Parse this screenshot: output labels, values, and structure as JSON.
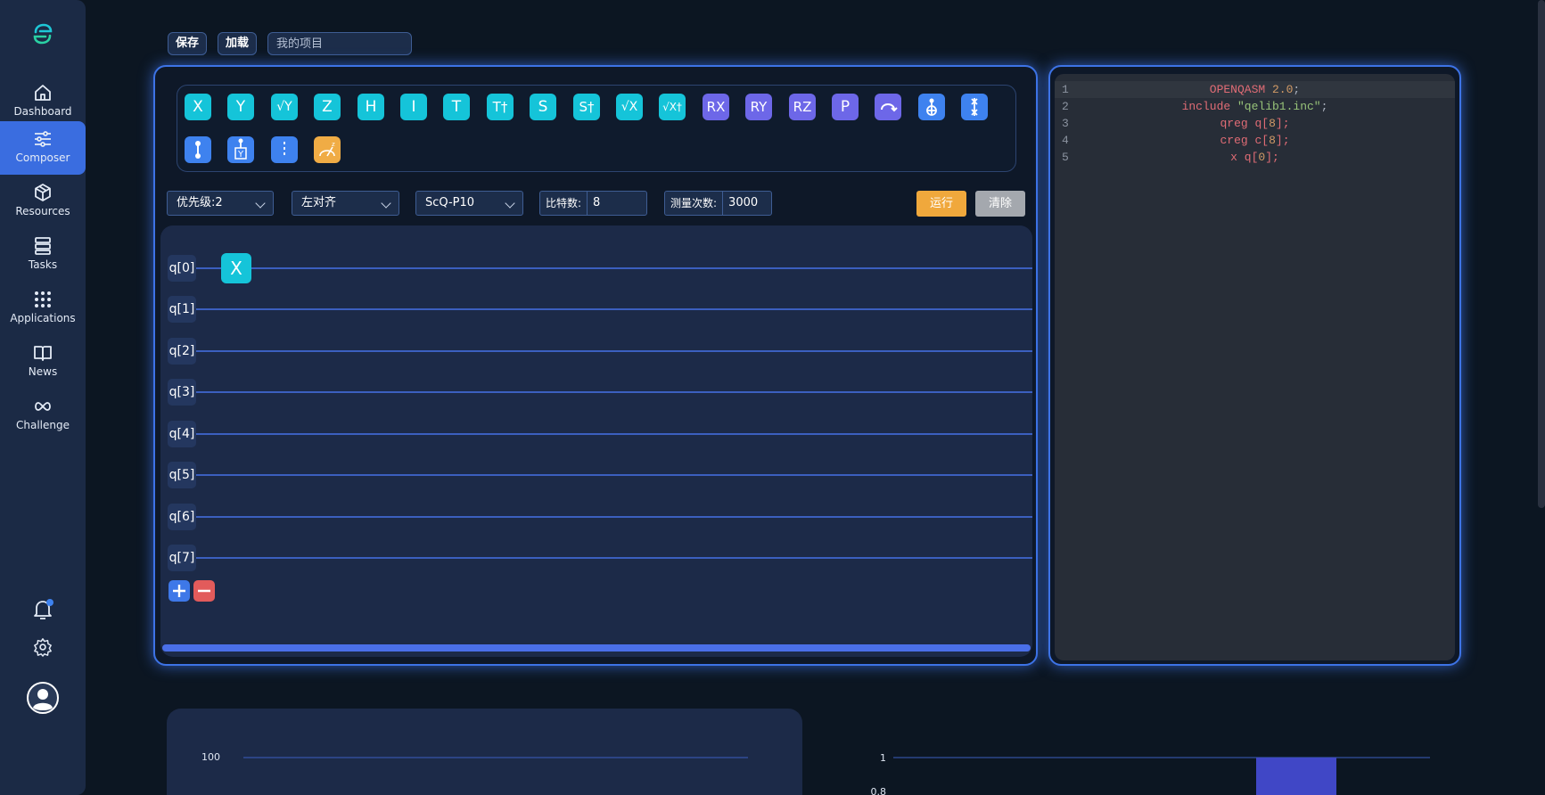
{
  "sidebar": {
    "items": [
      {
        "label": "Dashboard",
        "icon": "home-icon"
      },
      {
        "label": "Composer",
        "icon": "sliders-icon"
      },
      {
        "label": "Resources",
        "icon": "cube-icon"
      },
      {
        "label": "Tasks",
        "icon": "stack-icon"
      },
      {
        "label": "Applications",
        "icon": "grid-icon"
      },
      {
        "label": "News",
        "icon": "book-icon"
      },
      {
        "label": "Challenge",
        "icon": "infinity-icon"
      }
    ],
    "active": "Composer"
  },
  "toolbar": {
    "save_label": "保存",
    "load_label": "加载",
    "project_placeholder": "我的项目"
  },
  "gates": {
    "row1": [
      "X",
      "Y",
      "√Y",
      "Z",
      "H",
      "I",
      "T",
      "T†",
      "S",
      "S†",
      "√X",
      "√X†",
      "RX",
      "RY",
      "RZ",
      "P"
    ],
    "row1_icons": [
      "swap-arc-icon",
      "cnot-icon",
      "measure-x-icon"
    ],
    "row2_icons": [
      "control-dot-icon",
      "controlled-y-icon",
      "barrier-icon",
      "measure-icon"
    ]
  },
  "controls": {
    "priority": "优先级:2",
    "align": "左对齐",
    "device": "ScQ-P10",
    "qubits_label": "比特数:",
    "qubits_value": "8",
    "shots_label": "测量次数:",
    "shots_value": "3000",
    "run_label": "运行",
    "clear_label": "清除"
  },
  "circuit": {
    "qubits": [
      "q[0]",
      "q[1]",
      "q[2]",
      "q[3]",
      "q[4]",
      "q[5]",
      "q[6]",
      "q[7]"
    ],
    "placed_gates": [
      {
        "gate": "X",
        "qubit": "q[0]"
      }
    ]
  },
  "code": {
    "line_numbers": [
      "1",
      "2",
      "3",
      "4",
      "5"
    ],
    "l1_kw": "OPENQASM",
    "l1_num": "2.0",
    "l1_end": ";",
    "l2_kw": "include",
    "l2_str": "\"qelib1.inc\"",
    "l2_end": ";",
    "l3_kw": "qreg",
    "l3_a": "q[",
    "l3_num": "8",
    "l3_b": "];",
    "l4_kw": "creg",
    "l4_a": "c[",
    "l4_num": "8",
    "l4_b": "];",
    "l5_kw": "x",
    "l5_a": "q[",
    "l5_num": "0",
    "l5_b": "];"
  },
  "chart_data": [
    {
      "type": "bar",
      "y_ticks_visible": [
        "100"
      ],
      "categories": [],
      "values": []
    },
    {
      "type": "bar",
      "y_ticks_visible": [
        "1",
        "0.8"
      ],
      "series_color": "#4047c6",
      "values_visible": [
        1
      ]
    }
  ],
  "colors": {
    "accent": "#3d73e6",
    "gate_single": "#15c4d9",
    "gate_rotation": "#6d67e8",
    "gate_multi": "#3e82ef",
    "gate_measure": "#f0ac45",
    "run": "#f0a83c",
    "clear": "#a4a8ae"
  }
}
